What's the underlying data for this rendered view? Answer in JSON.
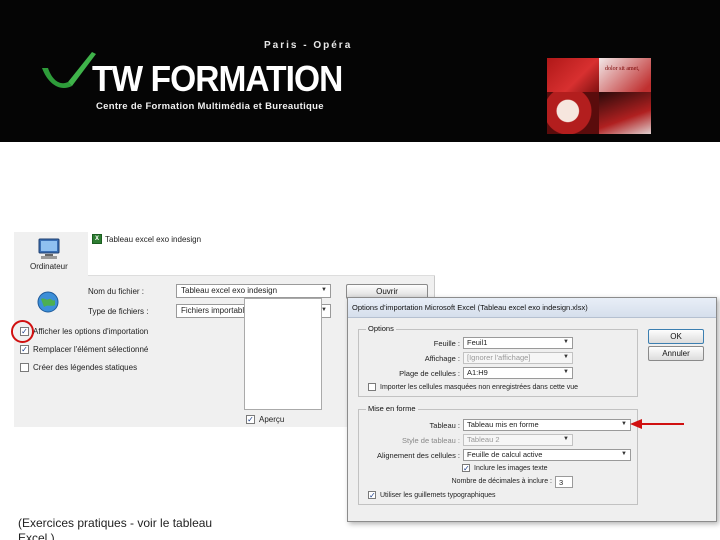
{
  "banner": {
    "tagline_top": "Paris - Opéra",
    "logo_text": "TW FORMATION",
    "tagline_bottom": "Centre de Formation Multimédia et Bureautique",
    "collage_text": "dolor sit amet,"
  },
  "save_dialog": {
    "nav_computer_label": "Ordinateur",
    "file_list_item": "Tableau excel exo indesign",
    "filename_label": "Nom du fichier :",
    "filename_value": "Tableau excel exo indesign",
    "filetype_label": "Type de fichiers :",
    "filetype_value": "Fichiers importables",
    "open_button": "Ouvrir",
    "show_import_options": "Afficher les options d'importation",
    "replace_selected": "Remplacer l'élément sélectionné",
    "create_static_captions": "Créer des légendes statiques",
    "preview_label": "Aperçu"
  },
  "import_dialog": {
    "title": "Options d'importation Microsoft Excel (Tableau excel exo indesign.xlsx)",
    "ok_button": "OK",
    "cancel_button": "Annuler",
    "options_group": "Options",
    "sheet_label": "Feuille :",
    "sheet_value": "Feuil1",
    "view_label": "Affichage :",
    "view_value": "[Ignorer l'affichage]",
    "cell_range_label": "Plage de cellules :",
    "cell_range_value": "A1:H9",
    "import_hidden_cells": "Importer les cellules masquées non enregistrées dans cette vue",
    "formatting_group": "Mise en forme",
    "table_label": "Tableau :",
    "table_value": "Tableau mis en forme",
    "table_style_label": "Style de tableau :",
    "table_style_value": "Tableau 2",
    "cell_alignment_label": "Alignement des cellules :",
    "cell_alignment_value": "Feuille de calcul active",
    "include_inline_images": "Inclure les images texte",
    "decimal_places_label": "Nombre de décimales à inclure :",
    "decimal_places_value": "3",
    "typographer_quotes": "Utiliser les guillemets typographiques"
  },
  "caption": {
    "line1": "(Exercices pratiques - voir le tableau",
    "line2": "Excel )"
  },
  "colors": {
    "banner_bg": "#050505",
    "highlight_red": "#d01010",
    "checkbox_mark": "#1d3f8a"
  }
}
